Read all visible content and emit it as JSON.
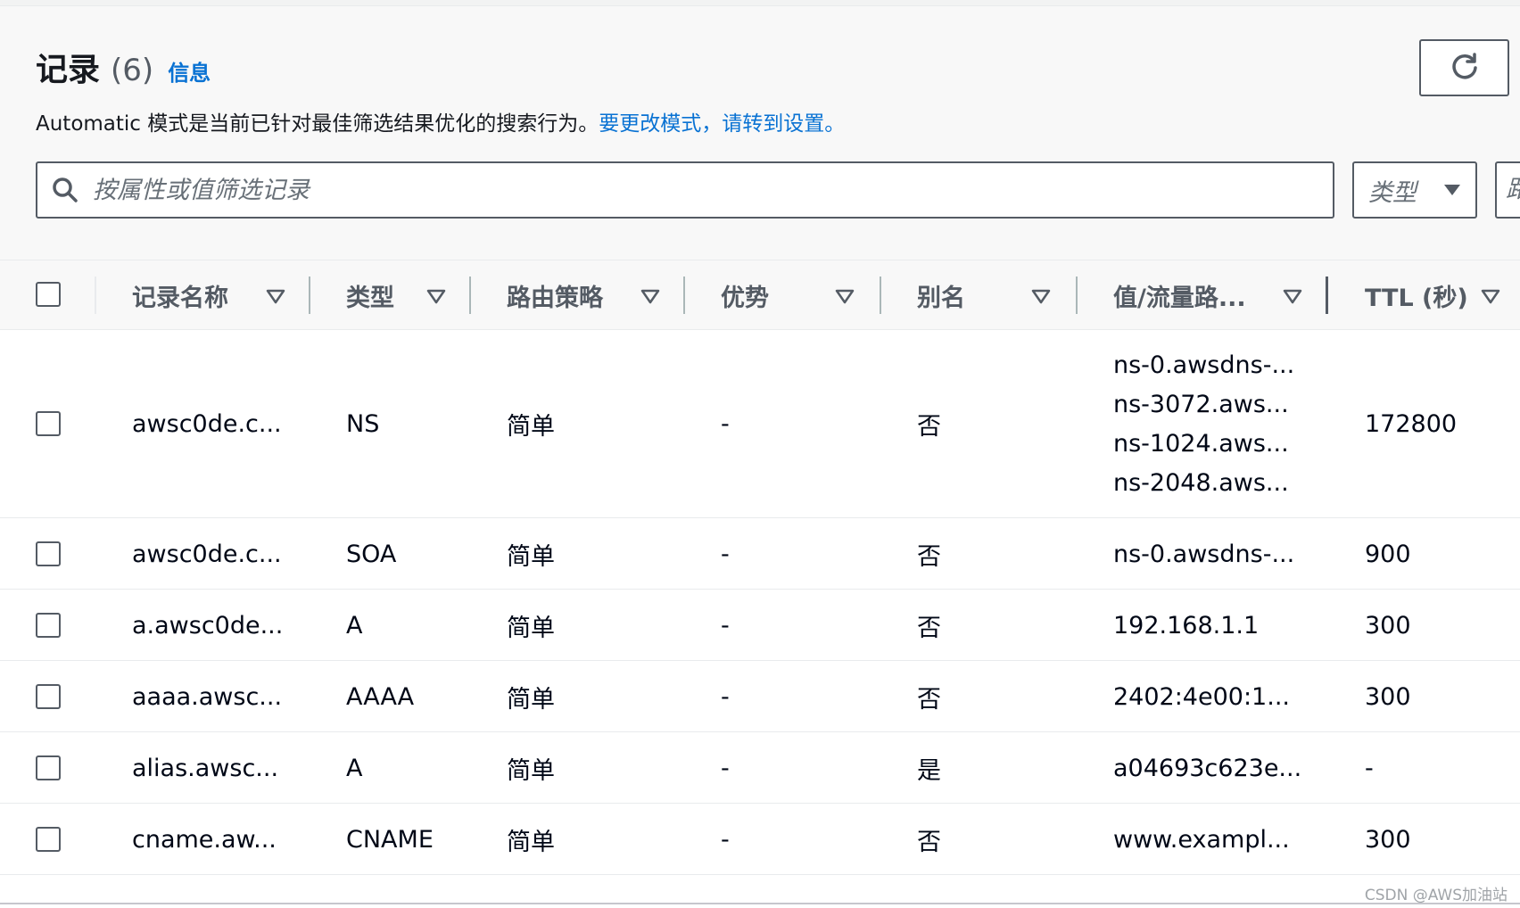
{
  "header": {
    "title": "记录",
    "count": "(6)",
    "info_link": "信息",
    "description_prefix": "Automatic 模式是当前已针对最佳筛选结果优化的搜索行为。",
    "description_link": "要更改模式，请转到设置。",
    "search_placeholder": "按属性或值筛选记录",
    "type_filter_label": "类型",
    "cut_filter_label": "路"
  },
  "columns": [
    {
      "label": "记录名称"
    },
    {
      "label": "类型"
    },
    {
      "label": "路由策略"
    },
    {
      "label": "优势"
    },
    {
      "label": "别名"
    },
    {
      "label": "值/流量路..."
    },
    {
      "label": "TTL (秒)"
    }
  ],
  "rows": [
    {
      "name": "awsc0de.c...",
      "type": "NS",
      "routing": "简单",
      "advantage": "-",
      "alias": "否",
      "values": [
        "ns-0.awsdns-...",
        "ns-3072.aws...",
        "ns-1024.aws...",
        "ns-2048.aws..."
      ],
      "ttl": "172800"
    },
    {
      "name": "awsc0de.c...",
      "type": "SOA",
      "routing": "简单",
      "advantage": "-",
      "alias": "否",
      "values": [
        "ns-0.awsdns-..."
      ],
      "ttl": "900"
    },
    {
      "name": "a.awsc0de...",
      "type": "A",
      "routing": "简单",
      "advantage": "-",
      "alias": "否",
      "values": [
        "192.168.1.1"
      ],
      "ttl": "300"
    },
    {
      "name": "aaaa.awsc...",
      "type": "AAAA",
      "routing": "简单",
      "advantage": "-",
      "alias": "否",
      "values": [
        "2402:4e00:1..."
      ],
      "ttl": "300"
    },
    {
      "name": "alias.awsc...",
      "type": "A",
      "routing": "简单",
      "advantage": "-",
      "alias": "是",
      "values": [
        "a04693c623e..."
      ],
      "ttl": "-"
    },
    {
      "name": "cname.aw...",
      "type": "CNAME",
      "routing": "简单",
      "advantage": "-",
      "alias": "否",
      "values": [
        "www.exampl..."
      ],
      "ttl": "300"
    }
  ],
  "watermark": "CSDN @AWS加油站",
  "colors": {
    "link": "#0972d3",
    "border": "#545b64",
    "header_bg": "#f8f8f8"
  }
}
